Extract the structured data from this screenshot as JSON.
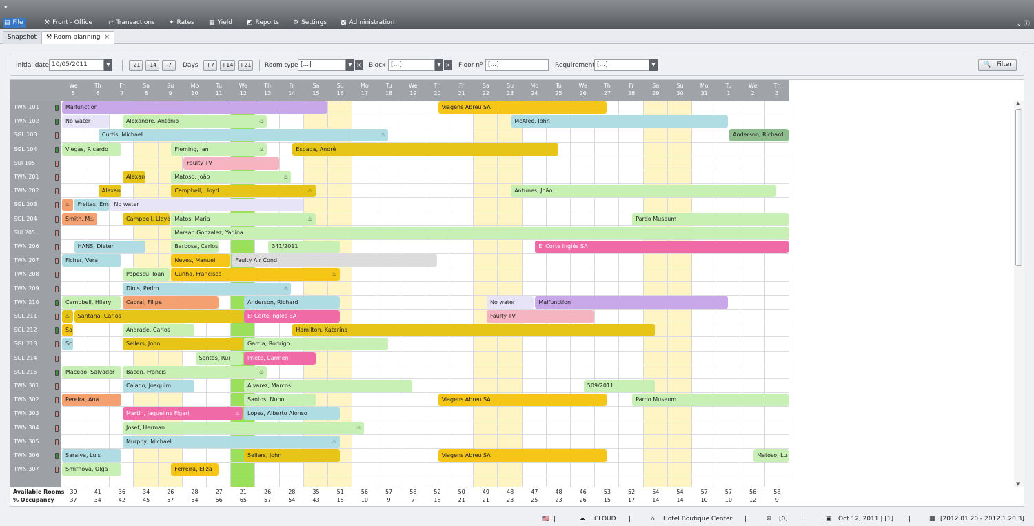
{
  "menu": [
    {
      "label": "File",
      "icon": "file-icon",
      "active": true
    },
    {
      "label": "Front - Office",
      "icon": "wrench-icon"
    },
    {
      "label": "Transactions",
      "icon": "transactions-icon"
    },
    {
      "label": "Rates",
      "icon": "rates-icon"
    },
    {
      "label": "Yield",
      "icon": "yield-icon"
    },
    {
      "label": "Reports",
      "icon": "reports-icon"
    },
    {
      "label": "Settings",
      "icon": "settings-icon"
    },
    {
      "label": "Administration",
      "icon": "administration-icon"
    }
  ],
  "tabs": {
    "snapshot": "Snapshot",
    "room_planning": "Room planning"
  },
  "filters": {
    "initial_date_label": "Initial date",
    "initial_date": "10/05/2011",
    "days_label": "Days",
    "nav_back": [
      "-21",
      "-14",
      "-7"
    ],
    "nav_fwd": [
      "+7",
      "+14",
      "+21"
    ],
    "room_type_label": "Room type",
    "room_type_value": "[...]",
    "block_label": "Block",
    "block_value": "[...]",
    "floor_label": "Floor nº",
    "floor_value": "[...]",
    "requirement_label": "Requirement",
    "requirement_value": "[...]",
    "filter_button": "Filter"
  },
  "days": [
    [
      "We",
      "5"
    ],
    [
      "Th",
      "6"
    ],
    [
      "Fr",
      "7"
    ],
    [
      "Sa",
      "8"
    ],
    [
      "Su",
      "9"
    ],
    [
      "Mo",
      "10"
    ],
    [
      "Tu",
      "11"
    ],
    [
      "We",
      "12"
    ],
    [
      "Th",
      "13"
    ],
    [
      "Fr",
      "14"
    ],
    [
      "Sa",
      "15"
    ],
    [
      "Su",
      "16"
    ],
    [
      "Mo",
      "17"
    ],
    [
      "Tu",
      "18"
    ],
    [
      "We",
      "19"
    ],
    [
      "Th",
      "20"
    ],
    [
      "Fr",
      "21"
    ],
    [
      "Sa",
      "22"
    ],
    [
      "Su",
      "23"
    ],
    [
      "Mo",
      "24"
    ],
    [
      "Tu",
      "25"
    ],
    [
      "We",
      "26"
    ],
    [
      "Th",
      "27"
    ],
    [
      "Fr",
      "28"
    ],
    [
      "Sa",
      "29"
    ],
    [
      "Su",
      "30"
    ],
    [
      "Mo",
      "31"
    ],
    [
      "Tu",
      "1"
    ],
    [
      "We",
      "2"
    ],
    [
      "Th",
      "3"
    ]
  ],
  "weekend_cols": [
    3,
    4,
    10,
    11,
    17,
    18,
    24,
    25
  ],
  "today_col": 7,
  "rooms": [
    {
      "name": "TWN 101",
      "status": "#3d8c3d"
    },
    {
      "name": "TWN 102",
      "status": "#3d8c3d"
    },
    {
      "name": "SGL 103",
      "status": "#c98a8a"
    },
    {
      "name": "SGL 104",
      "status": "#3d8c3d"
    },
    {
      "name": "SUI 105",
      "status": "#c98a8a"
    },
    {
      "name": "TWN 201",
      "status": "#c98a8a"
    },
    {
      "name": "TWN 202",
      "status": "#c98a8a"
    },
    {
      "name": "SGL 203",
      "status": "#c98a8a"
    },
    {
      "name": "SGL 204",
      "status": "#c98a8a"
    },
    {
      "name": "SUI 205",
      "status": "#c98a8a"
    },
    {
      "name": "TWN 206",
      "status": "#c98a8a"
    },
    {
      "name": "TWN 207",
      "status": "#c98a8a"
    },
    {
      "name": "TWN 208",
      "status": "#c98a8a"
    },
    {
      "name": "TWN 209",
      "status": "#c98a8a"
    },
    {
      "name": "TWN 210",
      "status": "#3d8c3d"
    },
    {
      "name": "SGL 211",
      "status": "#c98a8a"
    },
    {
      "name": "SGL 212",
      "status": "#3d8c3d"
    },
    {
      "name": "SGL 213",
      "status": "#c98a8a"
    },
    {
      "name": "SGL 214",
      "status": "#c98a8a"
    },
    {
      "name": "SGL 215",
      "status": "#3d8c3d"
    },
    {
      "name": "TWN 301",
      "status": "#c98a8a"
    },
    {
      "name": "TWN 302",
      "status": "#c98a8a"
    },
    {
      "name": "TWN 303",
      "status": "#c98a8a"
    },
    {
      "name": "TWN 304",
      "status": "#c98a8a"
    },
    {
      "name": "TWN 305",
      "status": "#c98a8a"
    },
    {
      "name": "TWN 306",
      "status": "#3d8c3d"
    },
    {
      "name": "TWN 307",
      "status": "#c98a8a"
    }
  ],
  "bookings": [
    {
      "row": 0,
      "start": 0,
      "end": 11,
      "label": "Malfunction",
      "color": "#c8a8e8"
    },
    {
      "row": 0,
      "start": 15.5,
      "end": 22.5,
      "label": "Viagens Abreu SA",
      "color": "#f5c518"
    },
    {
      "row": 1,
      "start": 0,
      "end": 2,
      "label": "No water",
      "color": "#e8e4f8"
    },
    {
      "row": 1,
      "start": 2.5,
      "end": 8.5,
      "label": "Alexandre, António",
      "color": "#c8f0b4",
      "icon": "♨"
    },
    {
      "row": 1,
      "start": 18.5,
      "end": 27.5,
      "label": "McAfee, John",
      "color": "#b0dce4"
    },
    {
      "row": 2,
      "start": 1.5,
      "end": 13.5,
      "label": "Curtis, Michael",
      "color": "#b0dce4",
      "icon": "♨"
    },
    {
      "row": 2,
      "start": 27.5,
      "end": 30,
      "label": "Anderson, Richard",
      "color": "#8cbc8c"
    },
    {
      "row": 3,
      "start": 0,
      "end": 2.5,
      "label": "Viegas, Ricardo",
      "color": "#c8f0b4"
    },
    {
      "row": 3,
      "start": 4.5,
      "end": 8.5,
      "label": "Fleming, Ian",
      "color": "#c8f0b4",
      "icon": "♨"
    },
    {
      "row": 3,
      "start": 9.5,
      "end": 20.5,
      "label": "Espada, André",
      "color": "#e6c418"
    },
    {
      "row": 4,
      "start": 5,
      "end": 9,
      "label": "Faulty TV",
      "color": "#f5b4c0"
    },
    {
      "row": 5,
      "start": 2.5,
      "end": 3.5,
      "label": "Alexan",
      "color": "#e6c418"
    },
    {
      "row": 5,
      "start": 4.5,
      "end": 9.5,
      "label": "Matoso, João",
      "color": "#c8f0b4",
      "icon": "♨"
    },
    {
      "row": 6,
      "start": 1.5,
      "end": 2.5,
      "label": "Alexan",
      "color": "#e6c418"
    },
    {
      "row": 6,
      "start": 4.5,
      "end": 10.5,
      "label": "Campbell, Lloyd",
      "color": "#e6c418",
      "icon": "♨"
    },
    {
      "row": 6,
      "start": 18.5,
      "end": 29.5,
      "label": "Antunes, João",
      "color": "#c8f0b4"
    },
    {
      "row": 7,
      "start": 0,
      "end": 0.5,
      "label": "",
      "color": "#f5a070",
      "icon": "♨"
    },
    {
      "row": 7,
      "start": 0.5,
      "end": 2,
      "label": "Freitas, Emar",
      "color": "#b0dce4"
    },
    {
      "row": 7,
      "start": 2,
      "end": 10,
      "label": "No water",
      "color": "#e8e4f8"
    },
    {
      "row": 8,
      "start": 0,
      "end": 1.5,
      "label": "Smith, M",
      "color": "#f5a070",
      "icon": "♨"
    },
    {
      "row": 8,
      "start": 2.5,
      "end": 4.5,
      "label": "Campbell, Lloyd",
      "color": "#e6c418"
    },
    {
      "row": 8,
      "start": 4.5,
      "end": 10.5,
      "label": "Matos, Maria",
      "color": "#c8f0b4",
      "icon": "♨"
    },
    {
      "row": 8,
      "start": 23.5,
      "end": 30,
      "label": "Pardo Museum",
      "color": "#c8f0b4"
    },
    {
      "row": 9,
      "start": 4.5,
      "end": 30,
      "label": "Marsan Gonzalez, Yadina",
      "color": "#c8f0b4"
    },
    {
      "row": 10,
      "start": 0.5,
      "end": 3.5,
      "label": "HANS, Dieter",
      "color": "#b0dce4"
    },
    {
      "row": 10,
      "start": 4.5,
      "end": 6.5,
      "label": "Barbosa, Carlos",
      "color": "#c8f0b4"
    },
    {
      "row": 10,
      "start": 8.5,
      "end": 11.5,
      "label": "341/2011",
      "color": "#c8f0b4"
    },
    {
      "row": 10,
      "start": 19.5,
      "end": 30,
      "label": "El Corte Inglés SA",
      "color": "#f06aa8"
    },
    {
      "row": 11,
      "start": 0,
      "end": 2.5,
      "label": "Ficher, Vera",
      "color": "#b0dce4"
    },
    {
      "row": 11,
      "start": 4.5,
      "end": 7,
      "label": "Neves, Manuel",
      "color": "#f5c518"
    },
    {
      "row": 11,
      "start": 7,
      "end": 15.5,
      "label": "Faulty Air Cond",
      "color": "#dcdcdc"
    },
    {
      "row": 12,
      "start": 2.5,
      "end": 4.5,
      "label": "Popescu, Ioan",
      "color": "#c8f0b4"
    },
    {
      "row": 12,
      "start": 4.5,
      "end": 11.5,
      "label": "Cunha, Francisca",
      "color": "#f5c518",
      "icon": "♨"
    },
    {
      "row": 13,
      "start": 2.5,
      "end": 9.5,
      "label": "Dinis, Pedro",
      "color": "#b0dce4",
      "icon": "♨"
    },
    {
      "row": 14,
      "start": 0,
      "end": 2.5,
      "label": "Campbell, Hilary",
      "color": "#c8f0b4"
    },
    {
      "row": 14,
      "start": 2.5,
      "end": 6.5,
      "label": "Cabral, Filipe",
      "color": "#f5a070"
    },
    {
      "row": 14,
      "start": 7.5,
      "end": 11.5,
      "label": "Anderson, Richard",
      "color": "#b0dce4"
    },
    {
      "row": 14,
      "start": 17.5,
      "end": 19.5,
      "label": "No water",
      "color": "#e8e4f8"
    },
    {
      "row": 14,
      "start": 19.5,
      "end": 27.5,
      "label": "Malfunction",
      "color": "#c8a8e8"
    },
    {
      "row": 15,
      "start": 0,
      "end": 0.5,
      "label": "",
      "color": "#e6c418",
      "icon": "♨"
    },
    {
      "row": 15,
      "start": 0.5,
      "end": 7.5,
      "label": "Santana, Carlos",
      "color": "#e6c418"
    },
    {
      "row": 15,
      "start": 7.5,
      "end": 11.5,
      "label": "El Corte Inglés SA",
      "color": "#f06aa8"
    },
    {
      "row": 15,
      "start": 17.5,
      "end": 22,
      "label": "Faulty TV",
      "color": "#f5b4c0"
    },
    {
      "row": 16,
      "start": 0,
      "end": 0.5,
      "label": "Sa",
      "color": "#f5c518"
    },
    {
      "row": 16,
      "start": 2.5,
      "end": 5.5,
      "label": "Andrade, Carlos",
      "color": "#c8f0b4"
    },
    {
      "row": 16,
      "start": 9.5,
      "end": 24.5,
      "label": "Hamilton, Katerina",
      "color": "#e6c418"
    },
    {
      "row": 17,
      "start": 0,
      "end": 0.5,
      "label": "Sc",
      "color": "#b0dce4"
    },
    {
      "row": 17,
      "start": 2.5,
      "end": 7.5,
      "label": "Sellers, John",
      "color": "#e6c418"
    },
    {
      "row": 17,
      "start": 7.5,
      "end": 13.5,
      "label": "Garcia, Rodrigo",
      "color": "#c8f0b4"
    },
    {
      "row": 18,
      "start": 5.5,
      "end": 7.5,
      "label": "Santos, Rui",
      "color": "#c8f0b4"
    },
    {
      "row": 18,
      "start": 7.5,
      "end": 10.5,
      "label": "Prieto, Carmen",
      "color": "#f06aa8"
    },
    {
      "row": 19,
      "start": 0,
      "end": 2.5,
      "label": "Macedo, Salvador",
      "color": "#c8f0b4"
    },
    {
      "row": 19,
      "start": 2.5,
      "end": 8.5,
      "label": "Bacon, Francis",
      "color": "#c8f0b4",
      "icon": "♨"
    },
    {
      "row": 20,
      "start": 2.5,
      "end": 5.5,
      "label": "Calado, Joaquim",
      "color": "#b0dce4"
    },
    {
      "row": 20,
      "start": 7.5,
      "end": 14.5,
      "label": "Alvarez, Marcos",
      "color": "#c8f0b4"
    },
    {
      "row": 20,
      "start": 21.5,
      "end": 24.5,
      "label": "509/2011",
      "color": "#c8f0b4"
    },
    {
      "row": 21,
      "start": 0,
      "end": 2.5,
      "label": "Pereira, Ana",
      "color": "#f5a070"
    },
    {
      "row": 21,
      "start": 7.5,
      "end": 10.5,
      "label": "Santos, Nuno",
      "color": "#c8f0b4"
    },
    {
      "row": 21,
      "start": 15.5,
      "end": 22.5,
      "label": "Viagens Abreu SA",
      "color": "#f5c518"
    },
    {
      "row": 21,
      "start": 23.5,
      "end": 30,
      "label": "Pardo Museum",
      "color": "#c8f0b4"
    },
    {
      "row": 22,
      "start": 2.5,
      "end": 7.5,
      "label": "Martin, Jaqueline Figari",
      "color": "#f06aa8",
      "icon": "♨"
    },
    {
      "row": 22,
      "start": 7.5,
      "end": 11.5,
      "label": "Lopez, Alberto Alonso",
      "color": "#b0dce4"
    },
    {
      "row": 23,
      "start": 2.5,
      "end": 12.5,
      "label": "Josef, Herman",
      "color": "#c8f0b4",
      "icon": "♨"
    },
    {
      "row": 24,
      "start": 2.5,
      "end": 11.5,
      "label": "Murphy, Michael",
      "color": "#b0dce4",
      "icon": "♨"
    },
    {
      "row": 25,
      "start": 0,
      "end": 2.5,
      "label": "Saraiva, Luis",
      "color": "#b0dce4"
    },
    {
      "row": 25,
      "start": 7.5,
      "end": 11.5,
      "label": "Sellers, John",
      "color": "#e6c418"
    },
    {
      "row": 25,
      "start": 15.5,
      "end": 22.5,
      "label": "Viagens Abreu SA",
      "color": "#f5c518"
    },
    {
      "row": 25,
      "start": 28.5,
      "end": 30,
      "label": "Matoso, Lu",
      "color": "#c8f0b4"
    },
    {
      "row": 26,
      "start": 0,
      "end": 2.5,
      "label": "Smirnova, Olga",
      "color": "#c8f0b4"
    },
    {
      "row": 26,
      "start": 4.5,
      "end": 6.5,
      "label": "Ferreira, Eliza",
      "color": "#f5c518"
    }
  ],
  "footer": {
    "available_label": "Available Rooms",
    "occupancy_label": "% Occupancy",
    "available": [
      "39",
      "41",
      "36",
      "34",
      "26",
      "28",
      "27",
      "21",
      "26",
      "28",
      "35",
      "51",
      "56",
      "57",
      "58",
      "52",
      "50",
      "49",
      "48",
      "47",
      "48",
      "46",
      "53",
      "52",
      "54",
      "54",
      "57",
      "57",
      "56",
      "58"
    ],
    "occupancy": [
      "37",
      "34",
      "42",
      "45",
      "57",
      "54",
      "56",
      "65",
      "57",
      "54",
      "43",
      "18",
      "10",
      "9",
      "7",
      "18",
      "21",
      "21",
      "23",
      "25",
      "23",
      "26",
      "15",
      "17",
      "14",
      "14",
      "10",
      "10",
      "12",
      "9"
    ]
  },
  "status": {
    "mode": "CLOUD",
    "hotel": "Hotel Boutique Center",
    "messages": "[0]",
    "date": "Oct 12, 2011 | [1]",
    "version": "[2012.01.20 - 2012.1.20.3]"
  }
}
